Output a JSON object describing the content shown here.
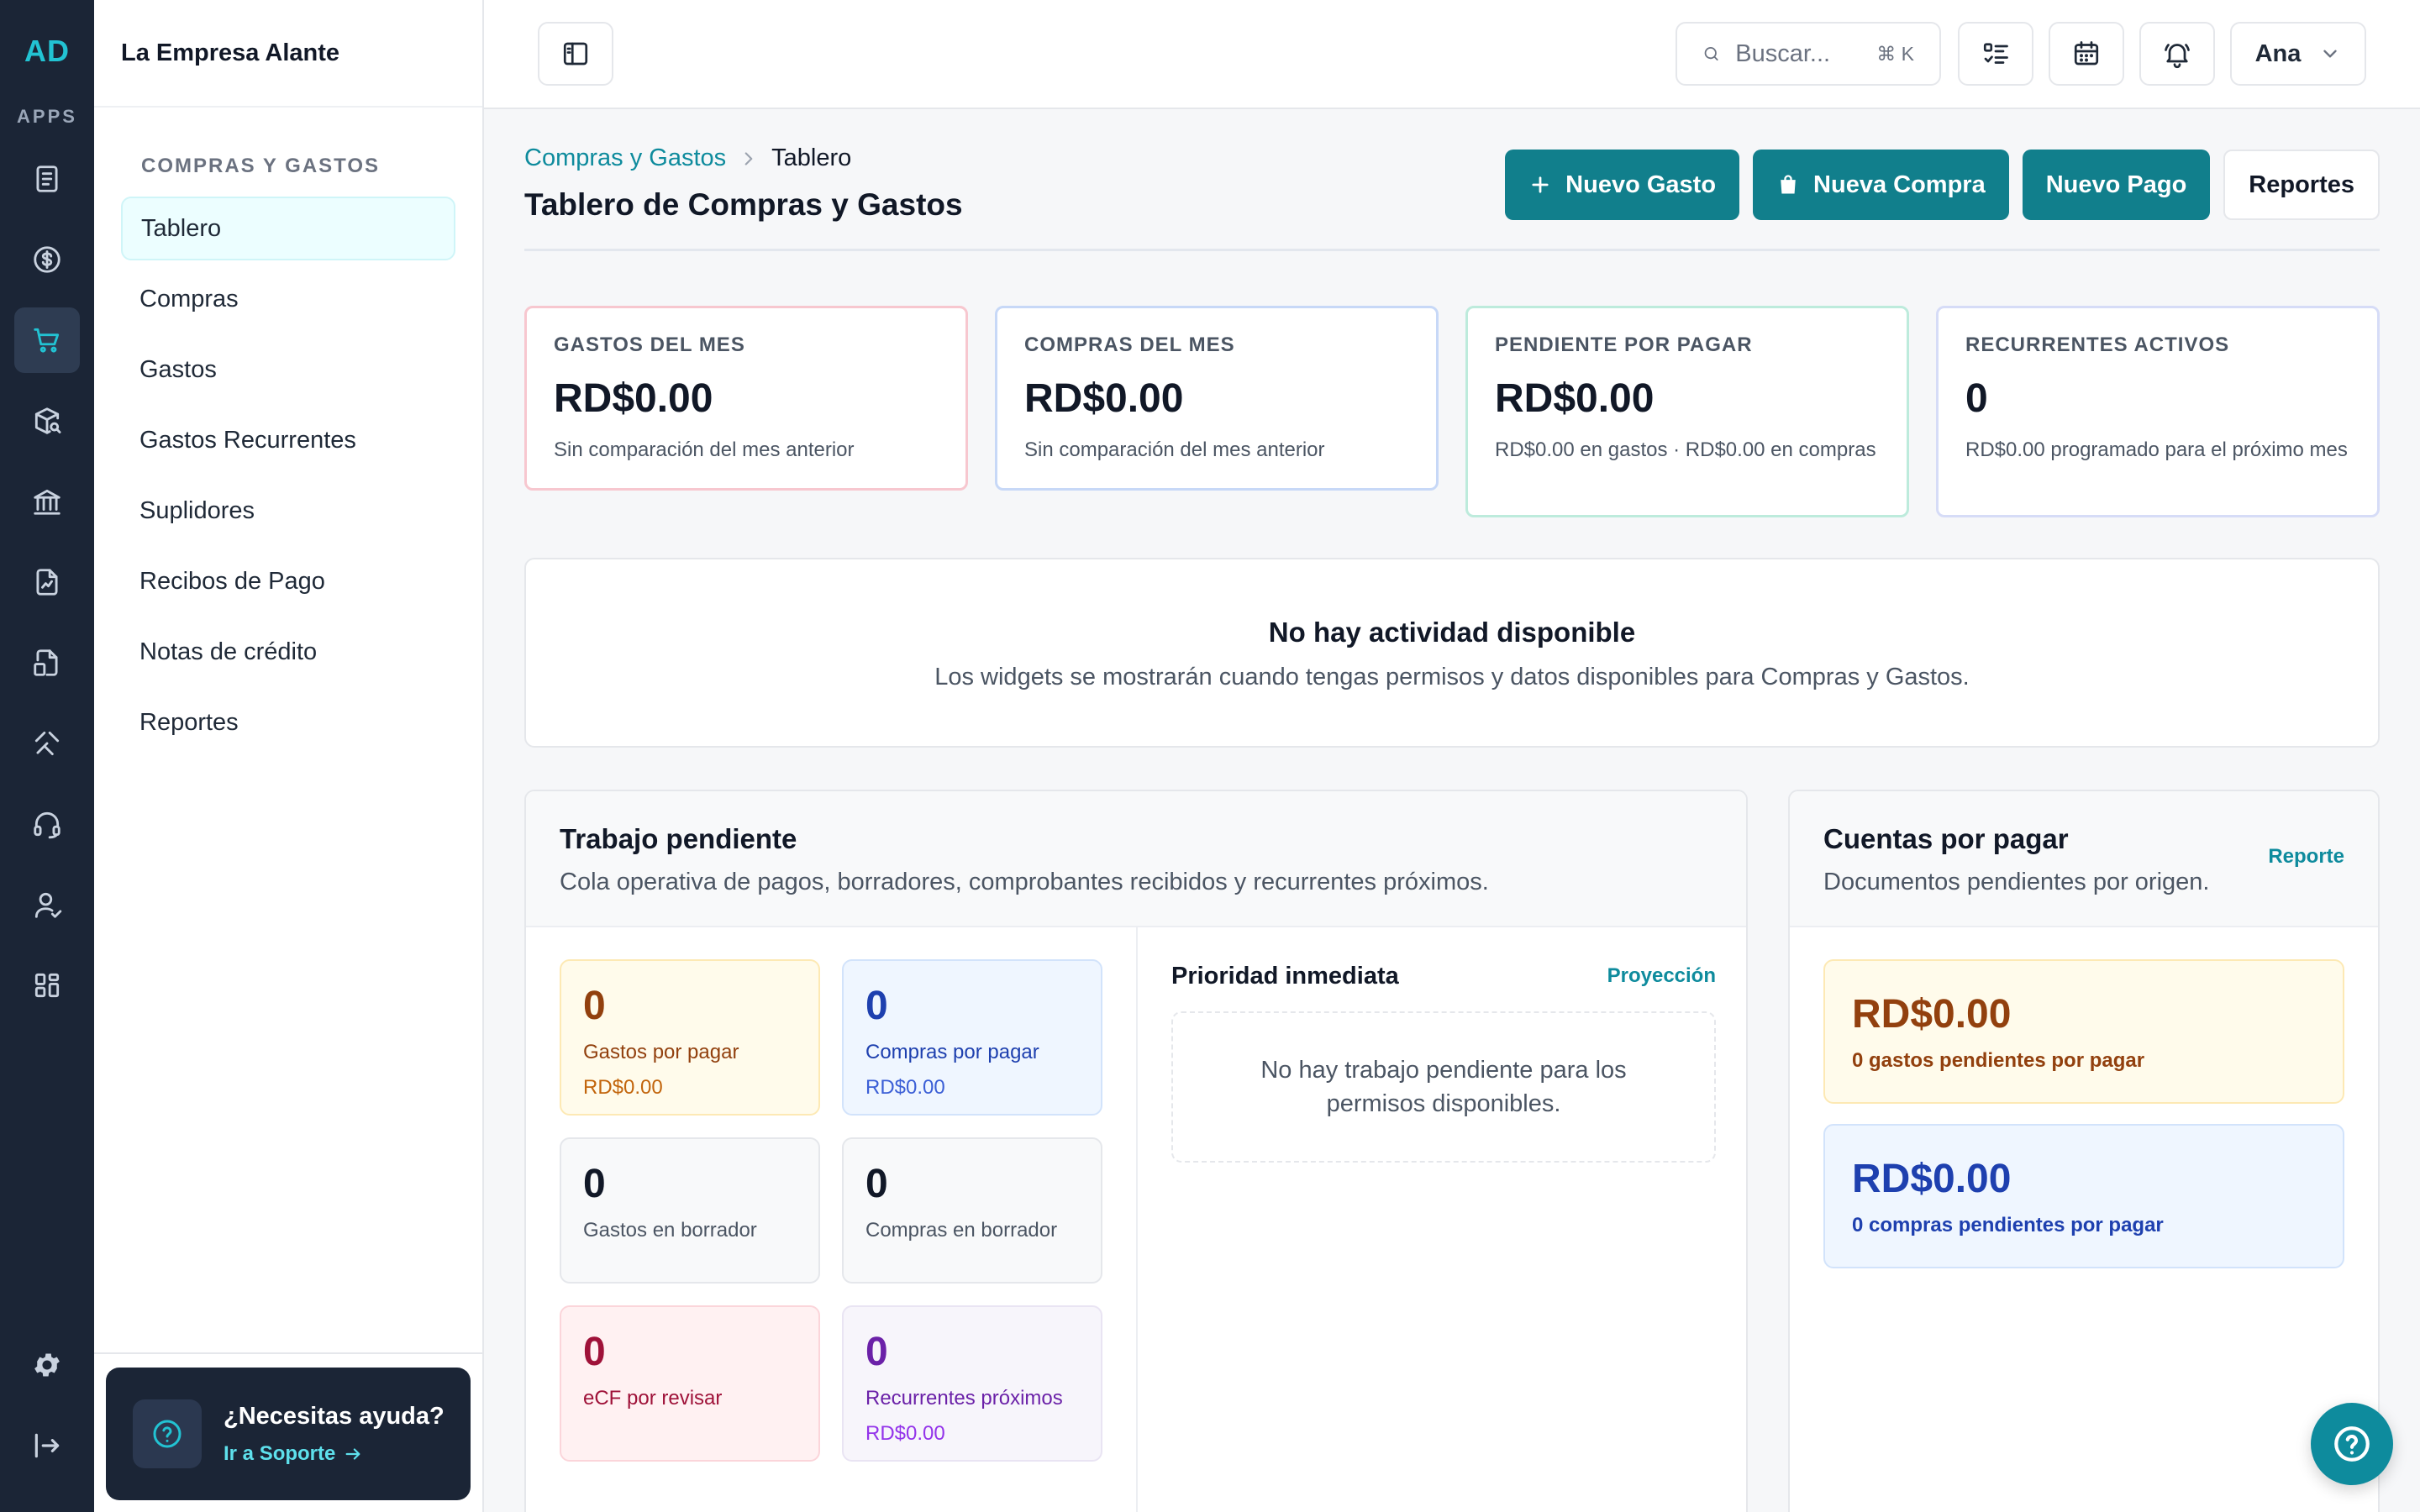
{
  "rail": {
    "logo": "AD",
    "apps_label": "APPS",
    "icons": [
      "document-icon",
      "dollar-icon",
      "cart-icon",
      "package-search-icon",
      "bank-icon",
      "report-chart-icon",
      "file-list-icon",
      "tools-icon",
      "headset-icon",
      "user-icon",
      "apps-grid-icon"
    ],
    "bottom_icons": [
      "settings-icon",
      "logout-icon"
    ],
    "active": "cart-icon"
  },
  "sidebar": {
    "company": "La Empresa Alante",
    "section": "COMPRAS Y GASTOS",
    "items": [
      {
        "label": "Tablero",
        "active": true
      },
      {
        "label": "Compras"
      },
      {
        "label": "Gastos"
      },
      {
        "label": "Gastos Recurrentes"
      },
      {
        "label": "Suplidores"
      },
      {
        "label": "Recibos de Pago"
      },
      {
        "label": "Notas de crédito"
      },
      {
        "label": "Reportes"
      }
    ],
    "help": {
      "title": "¿Necesitas ayuda?",
      "link": "Ir a Soporte"
    }
  },
  "topbar": {
    "search_placeholder": "Buscar...",
    "search_shortcut": "⌘ K",
    "user": "Ana"
  },
  "header": {
    "breadcrumb": [
      "Compras y Gastos",
      "Tablero"
    ],
    "title": "Tablero de Compras y Gastos",
    "actions": {
      "new_expense": "Nuevo Gasto",
      "new_purchase": "Nueva Compra",
      "new_payment": "Nuevo Pago",
      "reports": "Reportes"
    }
  },
  "stats": [
    {
      "label": "GASTOS DEL MES",
      "value": "RD$0.00",
      "sub": "Sin comparación del mes anterior"
    },
    {
      "label": "COMPRAS DEL MES",
      "value": "RD$0.00",
      "sub": "Sin comparación del mes anterior"
    },
    {
      "label": "PENDIENTE POR PAGAR",
      "value": "RD$0.00",
      "sub": "RD$0.00 en gastos · RD$0.00 en compras"
    },
    {
      "label": "RECURRENTES ACTIVOS",
      "value": "0",
      "sub": "RD$0.00 programado para el próximo mes"
    }
  ],
  "empty_activity": {
    "title": "No hay actividad disponible",
    "sub": "Los widgets se mostrarán cuando tengas permisos y datos disponibles para Compras y Gastos."
  },
  "pending_work": {
    "title": "Trabajo pendiente",
    "sub": "Cola operativa de pagos, borradores, comprobantes recibidos y recurrentes próximos.",
    "tiles": [
      {
        "value": "0",
        "label": "Gastos por pagar",
        "sub": "RD$0.00"
      },
      {
        "value": "0",
        "label": "Compras por pagar",
        "sub": "RD$0.00"
      },
      {
        "value": "0",
        "label": "Gastos en borrador"
      },
      {
        "value": "0",
        "label": "Compras en borrador"
      },
      {
        "value": "0",
        "label": "eCF por revisar"
      },
      {
        "value": "0",
        "label": "Recurrentes próximos",
        "sub": "RD$0.00"
      }
    ],
    "priority": {
      "title": "Prioridad inmediata",
      "link": "Proyección",
      "empty": "No hay trabajo pendiente para los permisos disponibles."
    }
  },
  "payables": {
    "title": "Cuentas por pagar",
    "sub": "Documentos pendientes por origen.",
    "link": "Reporte",
    "cards": [
      {
        "value": "RD$0.00",
        "label": "0 gastos pendientes por pagar"
      },
      {
        "value": "RD$0.00",
        "label": "0 compras pendientes por pagar"
      }
    ]
  },
  "colors": {
    "accent": "#117f8c",
    "rail_bg": "#1b2536",
    "rail_logo": "#22c3d3"
  }
}
